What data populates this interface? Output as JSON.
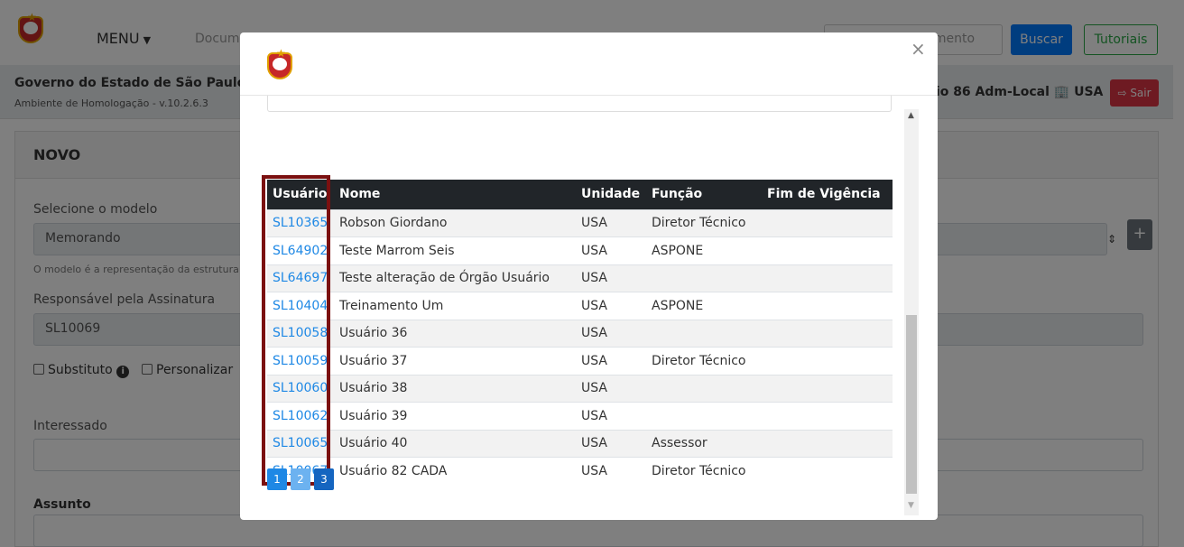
{
  "topbar": {
    "menu_label": "MENU",
    "doc_link": "Docum",
    "search_value": "umento",
    "buscar_label": "Buscar",
    "tutoriais_label": "Tutoriais"
  },
  "subbar": {
    "gov_title": "Governo do Estado de São Paulo >",
    "environment": "Ambiente de Homologação - v.10.2.6.3",
    "user_info": "rio 86 Adm-Local 🏢 USA",
    "sair_label": "Sair"
  },
  "form": {
    "title": "NOVO",
    "modelo_label": "Selecione o modelo",
    "modelo_value": "Memorando",
    "modelo_hint": "O modelo é a representação da estrutura d",
    "responsavel_label": "Responsável pela Assinatura",
    "responsavel_value": "SL10069",
    "substituto_label": "Substituto",
    "personalizar_label": "Personalizar",
    "interessado_label": "Interessado",
    "assunto_label": "Assunto",
    "plus_label": "+"
  },
  "modal": {
    "close_label": "×",
    "columns": [
      "Usuário",
      "Nome",
      "Unidade",
      "Função",
      "Fim de Vigência"
    ],
    "rows": [
      {
        "user": "SL10365",
        "nome": "Robson Giordano",
        "unidade": "USA",
        "funcao": "Diretor Técnico",
        "fim": ""
      },
      {
        "user": "SL64902",
        "nome": "Teste Marrom Seis",
        "unidade": "USA",
        "funcao": "ASPONE",
        "fim": ""
      },
      {
        "user": "SL64697",
        "nome": "Teste alteração de Órgão Usuário",
        "unidade": "USA",
        "funcao": "",
        "fim": ""
      },
      {
        "user": "SL10404",
        "nome": "Treinamento Um",
        "unidade": "USA",
        "funcao": "ASPONE",
        "fim": ""
      },
      {
        "user": "SL10058",
        "nome": "Usuário 36",
        "unidade": "USA",
        "funcao": "",
        "fim": ""
      },
      {
        "user": "SL10059",
        "nome": "Usuário 37",
        "unidade": "USA",
        "funcao": "Diretor Técnico",
        "fim": ""
      },
      {
        "user": "SL10060",
        "nome": "Usuário 38",
        "unidade": "USA",
        "funcao": "",
        "fim": ""
      },
      {
        "user": "SL10062",
        "nome": "Usuário 39",
        "unidade": "USA",
        "funcao": "",
        "fim": ""
      },
      {
        "user": "SL10065",
        "nome": "Usuário 40",
        "unidade": "USA",
        "funcao": "Assessor",
        "fim": ""
      },
      {
        "user": "SL10067",
        "nome": "Usuário 82 CADA",
        "unidade": "USA",
        "funcao": "Diretor Técnico",
        "fim": ""
      }
    ],
    "pages": [
      "1",
      "2",
      "3"
    ]
  },
  "colors": {
    "primary": "#007bff",
    "link": "#1e88e5",
    "header_dark": "#212529",
    "highlight": "#7b1010",
    "danger": "#dc3545",
    "success": "#28a745"
  }
}
